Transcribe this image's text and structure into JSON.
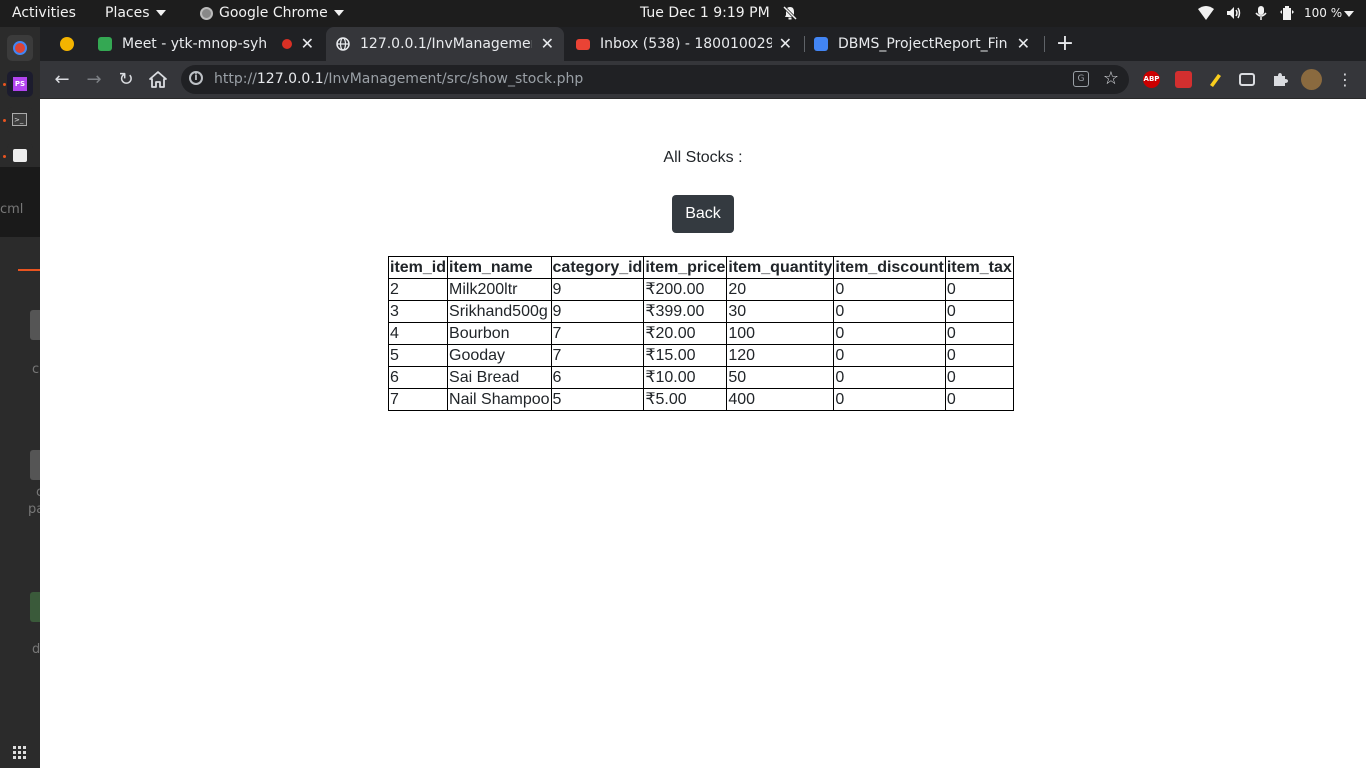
{
  "topbar": {
    "activities": "Activities",
    "places": "Places",
    "app_name": "Google Chrome",
    "datetime": "Tue Dec 1   9:19 PM",
    "battery": "100 %"
  },
  "tabs": [
    {
      "title": "",
      "favicon": "#f4b400"
    },
    {
      "title": "Meet - ytk-mnop-syh",
      "favicon": "#34a853"
    },
    {
      "title": "127.0.0.1/InvManagement",
      "favicon": "#e8eaed"
    },
    {
      "title": "Inbox (538) - 180010029@",
      "favicon": "#ea4335"
    },
    {
      "title": "DBMS_ProjectReport_Fin",
      "favicon": "#4285f4"
    }
  ],
  "omnibox": {
    "scheme": "http://",
    "host": "127.0.0.1",
    "path": "/InvManagement/src/show_stock.php"
  },
  "extensions": {
    "abp": "ABP"
  },
  "page": {
    "heading": "All Stocks :",
    "back_label": "Back"
  },
  "table": {
    "headers": [
      "item_id",
      "item_name",
      "category_id",
      "item_price",
      "item_quantity",
      "item_discount",
      "item_tax"
    ],
    "rows": [
      [
        "2",
        "Milk200ltr",
        "9",
        "₹200.00",
        "20",
        "0",
        "0"
      ],
      [
        "3",
        "Srikhand500g",
        "9",
        "₹399.00",
        "30",
        "0",
        "0"
      ],
      [
        "4",
        "Bourbon",
        "7",
        "₹20.00",
        "100",
        "0",
        "0"
      ],
      [
        "5",
        "Gooday",
        "7",
        "₹15.00",
        "120",
        "0",
        "0"
      ],
      [
        "6",
        "Sai Bread",
        "6",
        "₹10.00",
        "50",
        "0",
        "0"
      ],
      [
        "7",
        "Nail Shampoo",
        "5",
        "₹5.00",
        "400",
        "0",
        "0"
      ]
    ]
  },
  "dock_fragments": [
    "cml",
    "c",
    "c",
    "pa",
    "d"
  ]
}
